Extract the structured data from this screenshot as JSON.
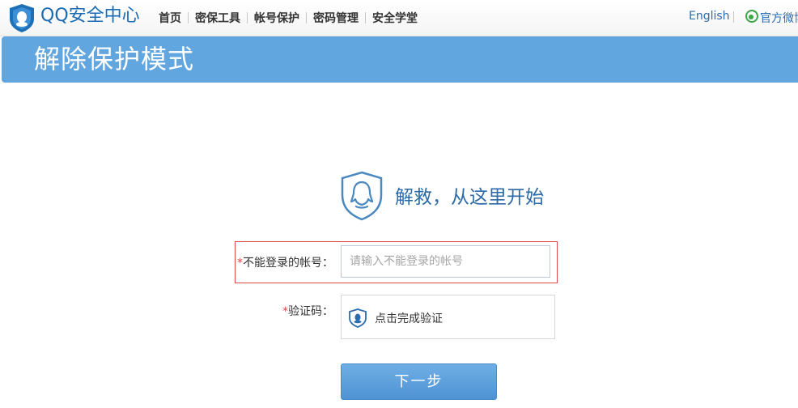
{
  "header": {
    "brand": "QQ安全中心",
    "nav": [
      {
        "label": "首页"
      },
      {
        "label": "密保工具"
      },
      {
        "label": "帐号保护"
      },
      {
        "label": "密码管理"
      },
      {
        "label": "安全学堂"
      }
    ],
    "language": "English",
    "weibo": "官方微博"
  },
  "band": {
    "title": "解除保护模式"
  },
  "hero": {
    "text": "解救，从这里开始"
  },
  "form": {
    "account_required_mark": "*",
    "account_label": "不能登录的帐号：",
    "account_placeholder": "请输入不能登录的帐号",
    "account_value": "",
    "captcha_required_mark": "*",
    "captcha_label": "验证码：",
    "captcha_action": "点击完成验证",
    "submit_label": "下一步"
  },
  "colors": {
    "band": "#62a6df",
    "brand": "#1a6bb3",
    "required": "#e54848",
    "button": "#5a9edc"
  },
  "icons": {
    "logo": "qq-shield-icon",
    "weibo": "weibo-icon",
    "hero": "qq-penguin-shield-icon",
    "captcha": "captcha-shield-icon"
  }
}
